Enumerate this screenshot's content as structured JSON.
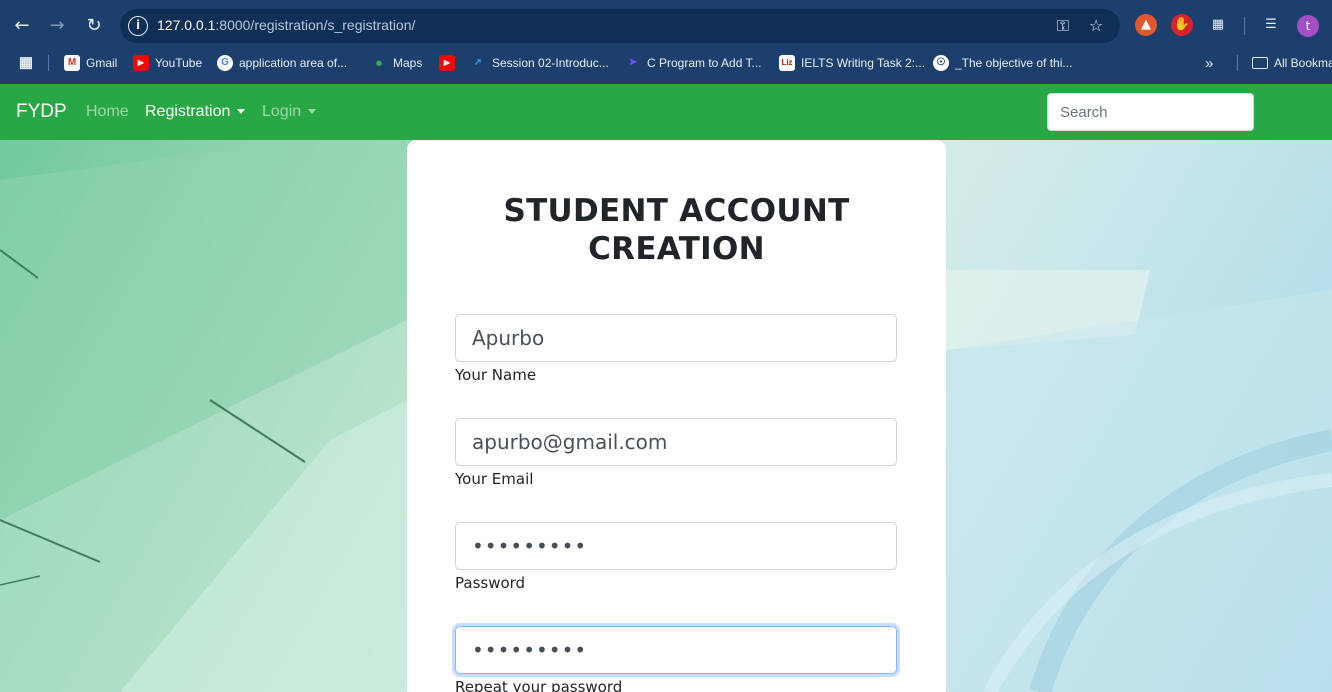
{
  "browser": {
    "url_host": "127.0.0.1",
    "url_rest": ":8000/registration/s_registration/",
    "avatar_letter": "t",
    "bookmarks": [
      {
        "label": "Gmail"
      },
      {
        "label": "YouTube"
      },
      {
        "label": "application area of..."
      },
      {
        "label": "Maps"
      },
      {
        "label": "Session 02-Introduc..."
      },
      {
        "label": "C Program to Add T..."
      },
      {
        "label": "IELTS Writing Task 2:..."
      },
      {
        "label": "_The objective of thi..."
      }
    ],
    "all_bookmarks": "All Bookmarks"
  },
  "navbar": {
    "brand": "FYDP",
    "home": "Home",
    "registration": "Registration",
    "login": "Login",
    "search_placeholder": "Search"
  },
  "form": {
    "title": "STUDENT ACCOUNT CREATION",
    "name_value": "Apurbo",
    "name_label": "Your Name",
    "email_value": "apurbo@gmail.com",
    "email_label": "Your Email",
    "password_value": "•••••••••",
    "password_label": "Password",
    "repeat_value": "•••••••••",
    "repeat_label": "Repeat your password"
  },
  "colors": {
    "chrome": "#1c3f6e",
    "navbar": "#28a745"
  }
}
